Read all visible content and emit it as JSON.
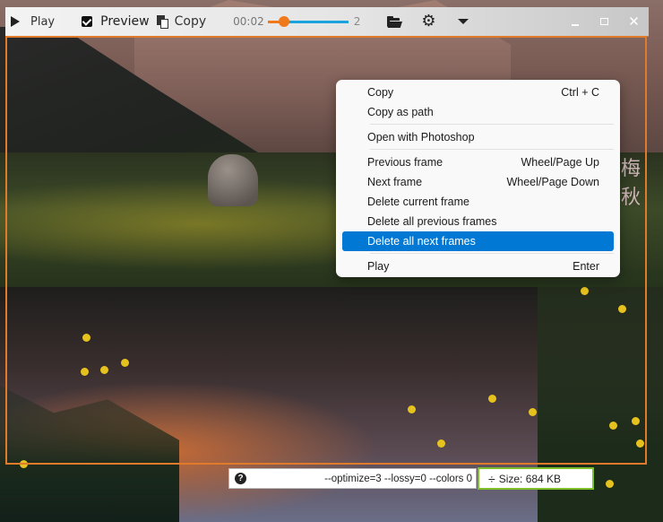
{
  "toolbar": {
    "play_label": "Play",
    "preview_label": "Preview",
    "preview_checked": true,
    "copy_label": "Copy",
    "time": "00:02",
    "slider_fraction": 0.2,
    "frame_count": "2",
    "icons": {
      "play": "play-icon",
      "preview": "checkbox-checked-icon",
      "copy": "copy-icon",
      "open": "folder-open-icon",
      "settings": "gear-icon",
      "more": "dropdown-icon",
      "minimize": "minimize-icon",
      "maximize": "maximize-icon",
      "close": "close-icon"
    },
    "gear_glyph": "⚙",
    "close_glyph": "✕"
  },
  "context_menu": {
    "items": [
      {
        "label": "Copy",
        "shortcut": "Ctrl + C"
      },
      {
        "label": "Copy as path",
        "shortcut": ""
      },
      {
        "separator": true
      },
      {
        "label": "Open with Photoshop",
        "shortcut": ""
      },
      {
        "separator": true
      },
      {
        "label": "Previous frame",
        "shortcut": "Wheel/Page Up"
      },
      {
        "label": "Next frame",
        "shortcut": "Wheel/Page Down"
      },
      {
        "label": "Delete current frame",
        "shortcut": ""
      },
      {
        "label": "Delete all previous frames",
        "shortcut": ""
      },
      {
        "label": "Delete all next frames",
        "shortcut": "",
        "selected": true
      },
      {
        "separator": true
      },
      {
        "label": "Play",
        "shortcut": "Enter"
      }
    ],
    "accent_color": "#0078d4"
  },
  "status": {
    "help_glyph": "?",
    "params": "--optimize=3 --lossy=0 --colors 0",
    "size_glyph": "÷",
    "size_label": "Size: 684 KB",
    "size_border_color": "#7fbf2a"
  },
  "image": {
    "watermark_text": "梅秋"
  },
  "colors": {
    "frame_border": "#e07b2c",
    "slider_played": "#f07a1b",
    "slider_remaining": "#1aa3dc"
  }
}
